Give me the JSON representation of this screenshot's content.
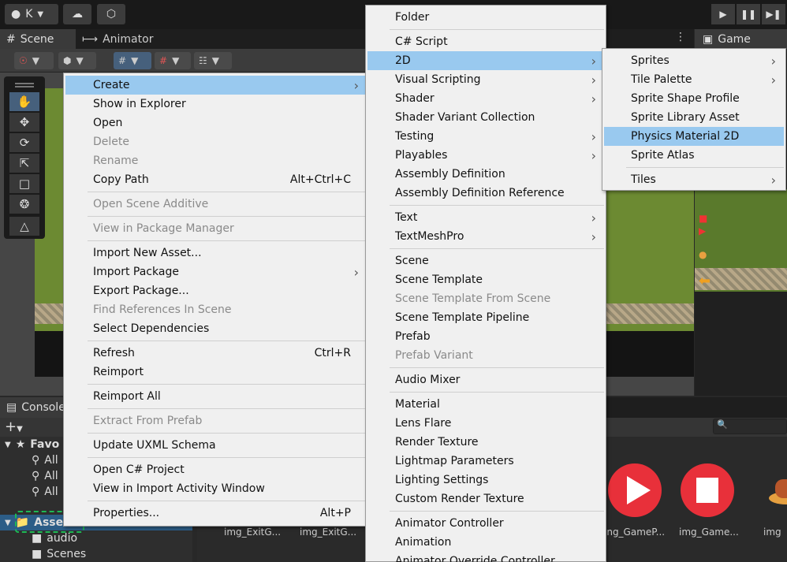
{
  "topbar": {
    "account_letter": "K"
  },
  "tabs": {
    "scene": "Scene",
    "animator": "Animator",
    "game": "Game",
    "console": "Console"
  },
  "project": {
    "favorites_label": "Favo",
    "favorite_items": [
      "All",
      "All",
      "All"
    ],
    "assets_label": "Assets",
    "folders": [
      "audio",
      "Scenes"
    ],
    "asset_labels": [
      "img_ExitG...",
      "img_ExitG...",
      "ing_GameP...",
      "img_Game...",
      "img"
    ]
  },
  "context_menu": {
    "items": [
      {
        "label": "Create",
        "submenu": true,
        "highlight": true
      },
      {
        "label": "Show in Explorer"
      },
      {
        "label": "Open"
      },
      {
        "label": "Delete",
        "disabled": true
      },
      {
        "label": "Rename",
        "disabled": true
      },
      {
        "label": "Copy Path",
        "shortcut": "Alt+Ctrl+C"
      },
      {
        "label": "Open Scene Additive",
        "disabled": true
      },
      {
        "label": "View in Package Manager",
        "disabled": true
      },
      {
        "label": "Import New Asset..."
      },
      {
        "label": "Import Package",
        "submenu": true
      },
      {
        "label": "Export Package..."
      },
      {
        "label": "Find References In Scene",
        "disabled": true
      },
      {
        "label": "Select Dependencies"
      },
      {
        "label": "Refresh",
        "shortcut": "Ctrl+R"
      },
      {
        "label": "Reimport"
      },
      {
        "label": "Reimport All"
      },
      {
        "label": "Extract From Prefab",
        "disabled": true
      },
      {
        "label": "Update UXML Schema"
      },
      {
        "label": "Open C# Project"
      },
      {
        "label": "View in Import Activity Window"
      },
      {
        "label": "Properties...",
        "shortcut": "Alt+P"
      }
    ]
  },
  "create_menu": {
    "items": [
      {
        "label": "Folder"
      },
      {
        "label": "C# Script"
      },
      {
        "label": "2D",
        "submenu": true,
        "highlight": true
      },
      {
        "label": "Visual Scripting",
        "submenu": true
      },
      {
        "label": "Shader",
        "submenu": true
      },
      {
        "label": "Shader Variant Collection"
      },
      {
        "label": "Testing",
        "submenu": true
      },
      {
        "label": "Playables",
        "submenu": true
      },
      {
        "label": "Assembly Definition"
      },
      {
        "label": "Assembly Definition Reference"
      },
      {
        "label": "Text",
        "submenu": true
      },
      {
        "label": "TextMeshPro",
        "submenu": true
      },
      {
        "label": "Scene"
      },
      {
        "label": "Scene Template"
      },
      {
        "label": "Scene Template From Scene",
        "disabled": true
      },
      {
        "label": "Scene Template Pipeline"
      },
      {
        "label": "Prefab"
      },
      {
        "label": "Prefab Variant",
        "disabled": true
      },
      {
        "label": "Audio Mixer"
      },
      {
        "label": "Material"
      },
      {
        "label": "Lens Flare"
      },
      {
        "label": "Render Texture"
      },
      {
        "label": "Lightmap Parameters"
      },
      {
        "label": "Lighting Settings"
      },
      {
        "label": "Custom Render Texture"
      },
      {
        "label": "Animator Controller"
      },
      {
        "label": "Animation"
      },
      {
        "label": "Animator Override Controller"
      }
    ]
  },
  "menu_2d": {
    "items": [
      {
        "label": "Sprites",
        "submenu": true
      },
      {
        "label": "Tile Palette",
        "submenu": true
      },
      {
        "label": "Sprite Shape Profile"
      },
      {
        "label": "Sprite Library Asset"
      },
      {
        "label": "Physics Material 2D",
        "highlight": true
      },
      {
        "label": "Sprite Atlas"
      },
      {
        "label": "Tiles",
        "submenu": true
      }
    ]
  },
  "colors": {
    "menu_highlight": "#99c9ef",
    "selection": "#2c5d87",
    "outline": "#1db954"
  }
}
